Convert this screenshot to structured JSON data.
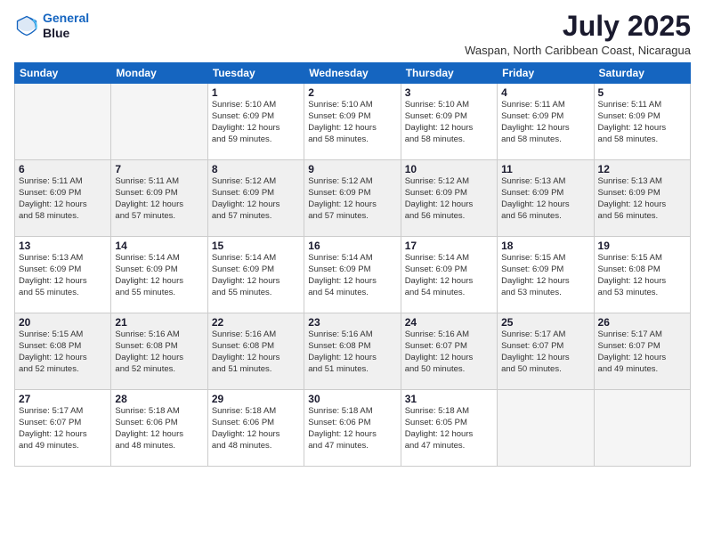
{
  "logo": {
    "line1": "General",
    "line2": "Blue"
  },
  "title": "July 2025",
  "subtitle": "Waspan, North Caribbean Coast, Nicaragua",
  "days_header": [
    "Sunday",
    "Monday",
    "Tuesday",
    "Wednesday",
    "Thursday",
    "Friday",
    "Saturday"
  ],
  "weeks": [
    {
      "shaded": false,
      "days": [
        {
          "num": "",
          "info": ""
        },
        {
          "num": "",
          "info": ""
        },
        {
          "num": "1",
          "info": "Sunrise: 5:10 AM\nSunset: 6:09 PM\nDaylight: 12 hours\nand 59 minutes."
        },
        {
          "num": "2",
          "info": "Sunrise: 5:10 AM\nSunset: 6:09 PM\nDaylight: 12 hours\nand 58 minutes."
        },
        {
          "num": "3",
          "info": "Sunrise: 5:10 AM\nSunset: 6:09 PM\nDaylight: 12 hours\nand 58 minutes."
        },
        {
          "num": "4",
          "info": "Sunrise: 5:11 AM\nSunset: 6:09 PM\nDaylight: 12 hours\nand 58 minutes."
        },
        {
          "num": "5",
          "info": "Sunrise: 5:11 AM\nSunset: 6:09 PM\nDaylight: 12 hours\nand 58 minutes."
        }
      ]
    },
    {
      "shaded": true,
      "days": [
        {
          "num": "6",
          "info": "Sunrise: 5:11 AM\nSunset: 6:09 PM\nDaylight: 12 hours\nand 58 minutes."
        },
        {
          "num": "7",
          "info": "Sunrise: 5:11 AM\nSunset: 6:09 PM\nDaylight: 12 hours\nand 57 minutes."
        },
        {
          "num": "8",
          "info": "Sunrise: 5:12 AM\nSunset: 6:09 PM\nDaylight: 12 hours\nand 57 minutes."
        },
        {
          "num": "9",
          "info": "Sunrise: 5:12 AM\nSunset: 6:09 PM\nDaylight: 12 hours\nand 57 minutes."
        },
        {
          "num": "10",
          "info": "Sunrise: 5:12 AM\nSunset: 6:09 PM\nDaylight: 12 hours\nand 56 minutes."
        },
        {
          "num": "11",
          "info": "Sunrise: 5:13 AM\nSunset: 6:09 PM\nDaylight: 12 hours\nand 56 minutes."
        },
        {
          "num": "12",
          "info": "Sunrise: 5:13 AM\nSunset: 6:09 PM\nDaylight: 12 hours\nand 56 minutes."
        }
      ]
    },
    {
      "shaded": false,
      "days": [
        {
          "num": "13",
          "info": "Sunrise: 5:13 AM\nSunset: 6:09 PM\nDaylight: 12 hours\nand 55 minutes."
        },
        {
          "num": "14",
          "info": "Sunrise: 5:14 AM\nSunset: 6:09 PM\nDaylight: 12 hours\nand 55 minutes."
        },
        {
          "num": "15",
          "info": "Sunrise: 5:14 AM\nSunset: 6:09 PM\nDaylight: 12 hours\nand 55 minutes."
        },
        {
          "num": "16",
          "info": "Sunrise: 5:14 AM\nSunset: 6:09 PM\nDaylight: 12 hours\nand 54 minutes."
        },
        {
          "num": "17",
          "info": "Sunrise: 5:14 AM\nSunset: 6:09 PM\nDaylight: 12 hours\nand 54 minutes."
        },
        {
          "num": "18",
          "info": "Sunrise: 5:15 AM\nSunset: 6:09 PM\nDaylight: 12 hours\nand 53 minutes."
        },
        {
          "num": "19",
          "info": "Sunrise: 5:15 AM\nSunset: 6:08 PM\nDaylight: 12 hours\nand 53 minutes."
        }
      ]
    },
    {
      "shaded": true,
      "days": [
        {
          "num": "20",
          "info": "Sunrise: 5:15 AM\nSunset: 6:08 PM\nDaylight: 12 hours\nand 52 minutes."
        },
        {
          "num": "21",
          "info": "Sunrise: 5:16 AM\nSunset: 6:08 PM\nDaylight: 12 hours\nand 52 minutes."
        },
        {
          "num": "22",
          "info": "Sunrise: 5:16 AM\nSunset: 6:08 PM\nDaylight: 12 hours\nand 51 minutes."
        },
        {
          "num": "23",
          "info": "Sunrise: 5:16 AM\nSunset: 6:08 PM\nDaylight: 12 hours\nand 51 minutes."
        },
        {
          "num": "24",
          "info": "Sunrise: 5:16 AM\nSunset: 6:07 PM\nDaylight: 12 hours\nand 50 minutes."
        },
        {
          "num": "25",
          "info": "Sunrise: 5:17 AM\nSunset: 6:07 PM\nDaylight: 12 hours\nand 50 minutes."
        },
        {
          "num": "26",
          "info": "Sunrise: 5:17 AM\nSunset: 6:07 PM\nDaylight: 12 hours\nand 49 minutes."
        }
      ]
    },
    {
      "shaded": false,
      "days": [
        {
          "num": "27",
          "info": "Sunrise: 5:17 AM\nSunset: 6:07 PM\nDaylight: 12 hours\nand 49 minutes."
        },
        {
          "num": "28",
          "info": "Sunrise: 5:18 AM\nSunset: 6:06 PM\nDaylight: 12 hours\nand 48 minutes."
        },
        {
          "num": "29",
          "info": "Sunrise: 5:18 AM\nSunset: 6:06 PM\nDaylight: 12 hours\nand 48 minutes."
        },
        {
          "num": "30",
          "info": "Sunrise: 5:18 AM\nSunset: 6:06 PM\nDaylight: 12 hours\nand 47 minutes."
        },
        {
          "num": "31",
          "info": "Sunrise: 5:18 AM\nSunset: 6:05 PM\nDaylight: 12 hours\nand 47 minutes."
        },
        {
          "num": "",
          "info": ""
        },
        {
          "num": "",
          "info": ""
        }
      ]
    }
  ]
}
